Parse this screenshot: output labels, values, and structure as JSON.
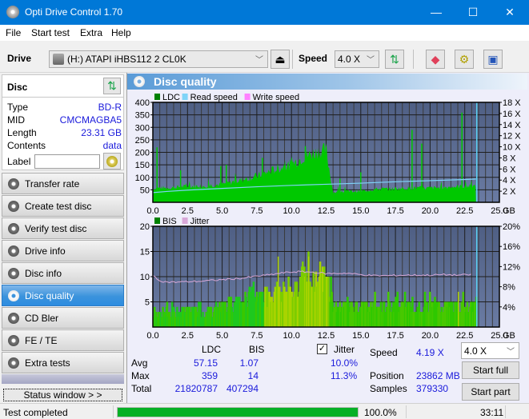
{
  "window": {
    "title": "Opti Drive Control 1.70",
    "minimize": "—",
    "maximize": "☐",
    "close": "✕"
  },
  "menu": [
    "File",
    "Start test",
    "Extra",
    "Help"
  ],
  "toolbar": {
    "drive_label": "Drive",
    "drive_value": "(H:)  ATAPI iHBS112  2 CL0K",
    "speed_label": "Speed",
    "speed_value": "4.0 X",
    "eject_icon": "eject-icon",
    "refresh_icon": "refresh-icon",
    "erase_icon": "eraser-icon",
    "settings_icon": "gears-icon",
    "save_icon": "save-icon"
  },
  "disc": {
    "header": "Disc",
    "type_label": "Type",
    "type_value": "BD-R",
    "mid_label": "MID",
    "mid_value": "CMCMAGBA5",
    "length_label": "Length",
    "length_value": "23.31 GB",
    "contents_label": "Contents",
    "contents_value": "data",
    "label_label": "Label",
    "label_value": ""
  },
  "nav": [
    {
      "label": "Transfer rate",
      "active": false
    },
    {
      "label": "Create test disc",
      "active": false
    },
    {
      "label": "Verify test disc",
      "active": false
    },
    {
      "label": "Drive info",
      "active": false
    },
    {
      "label": "Disc info",
      "active": false
    },
    {
      "label": "Disc quality",
      "active": true
    },
    {
      "label": "CD Bler",
      "active": false
    },
    {
      "label": "FE / TE",
      "active": false
    },
    {
      "label": "Extra tests",
      "active": false
    }
  ],
  "status_window_button": "Status window > >",
  "panel": {
    "title": "Disc quality"
  },
  "colors": {
    "ldc": "#00c800",
    "read_speed": "#7fd4f8",
    "write_speed": "#ff80ff",
    "bis": "#00c800",
    "jitter": "#d8a8d8",
    "plot_bg_top": "#4f5f84",
    "plot_bg_bottom": "#6a7ba3",
    "accent": "#0078d7"
  },
  "chart_data": [
    {
      "type": "area",
      "title": "LDC",
      "legend": [
        "LDC",
        "Read speed",
        "Write speed"
      ],
      "legend_position": "top-left",
      "xlabel": "GB",
      "x_ticks": [
        "0.0",
        "2.5",
        "5.0",
        "7.5",
        "10.0",
        "12.5",
        "15.0",
        "17.5",
        "20.0",
        "22.5",
        "25.0"
      ],
      "xlim": [
        0,
        25
      ],
      "y_ticks_left": [
        "50",
        "100",
        "150",
        "200",
        "250",
        "300",
        "350",
        "400"
      ],
      "ylim_left": [
        0,
        400
      ],
      "y_ticks_right": [
        "2 X",
        "4 X",
        "6 X",
        "8 X",
        "10 X",
        "12 X",
        "14 X",
        "16 X",
        "18 X"
      ],
      "ylim_right": [
        0,
        18
      ],
      "grid": true,
      "end_marker_x": 23.31,
      "series": [
        {
          "name": "LDC",
          "x": [
            0,
            0.5,
            1,
            1.5,
            2,
            2.5,
            3,
            3.5,
            4,
            4.5,
            5,
            5.5,
            6,
            6.5,
            7,
            7.5,
            8,
            8.5,
            9,
            9.5,
            10,
            10.5,
            11,
            11.5,
            12,
            12.5,
            13,
            13.5,
            14,
            14.5,
            15,
            15.5,
            16,
            16.5,
            17,
            17.5,
            18,
            18.5,
            19,
            19.5,
            20,
            20.5,
            21,
            21.5,
            22,
            22.5,
            23,
            23.31
          ],
          "values": [
            55,
            58,
            57,
            60,
            62,
            63,
            64,
            66,
            68,
            70,
            72,
            78,
            85,
            90,
            98,
            105,
            115,
            125,
            135,
            143,
            152,
            168,
            185,
            195,
            205,
            210,
            40,
            42,
            43,
            44,
            45,
            48,
            52,
            54,
            53,
            55,
            56,
            57,
            58,
            56,
            57,
            58,
            60,
            62,
            63,
            64,
            65,
            62
          ],
          "spikes": [
            {
              "x": 0.3,
              "v": 220
            },
            {
              "x": 2.0,
              "v": 128
            },
            {
              "x": 4.9,
              "v": 145
            },
            {
              "x": 5.3,
              "v": 150
            },
            {
              "x": 7.9,
              "v": 178
            },
            {
              "x": 11.0,
              "v": 225
            },
            {
              "x": 13.5,
              "v": 95
            },
            {
              "x": 15.0,
              "v": 120
            },
            {
              "x": 18.7,
              "v": 290
            },
            {
              "x": 19.4,
              "v": 235
            },
            {
              "x": 22.3,
              "v": 359
            }
          ]
        },
        {
          "name": "Read speed",
          "unit": "X",
          "x": [
            0,
            1,
            2.5,
            5,
            7.5,
            10,
            12.5,
            15,
            17.5,
            20,
            22.5,
            23.31
          ],
          "values": [
            1.75,
            1.95,
            2.2,
            2.5,
            2.8,
            3.05,
            3.25,
            3.45,
            3.7,
            3.9,
            4.1,
            4.19
          ]
        }
      ]
    },
    {
      "type": "bar",
      "title": "BIS",
      "legend": [
        "BIS",
        "Jitter"
      ],
      "legend_position": "top-left",
      "xlabel": "GB",
      "x_ticks": [
        "0.0",
        "2.5",
        "5.0",
        "7.5",
        "10.0",
        "12.5",
        "15.0",
        "17.5",
        "20.0",
        "22.5",
        "25.0"
      ],
      "xlim": [
        0,
        25
      ],
      "y_ticks_left": [
        "5",
        "10",
        "15",
        "20"
      ],
      "ylim_left": [
        0,
        20
      ],
      "y_ticks_right": [
        "4%",
        "8%",
        "12%",
        "16%",
        "20%"
      ],
      "ylim_right": [
        0,
        20
      ],
      "grid": true,
      "end_marker_x": 23.31,
      "series": [
        {
          "name": "BIS",
          "x": [
            0,
            0.5,
            1,
            1.5,
            2,
            2.5,
            3,
            3.5,
            4,
            4.5,
            5,
            5.5,
            6,
            6.5,
            7,
            7.5,
            8,
            8.5,
            9,
            9.5,
            10,
            10.5,
            11,
            11.5,
            12,
            12.5,
            13,
            13.5,
            14,
            14.5,
            15,
            15.5,
            16,
            16.5,
            17,
            17.5,
            18,
            18.5,
            19,
            19.5,
            20,
            20.5,
            21,
            21.5,
            22,
            22.5,
            23
          ],
          "values": [
            4,
            3,
            3,
            3,
            4,
            4,
            4,
            4,
            4,
            5,
            5,
            6,
            6,
            6,
            7,
            8,
            8,
            8,
            9,
            9,
            9,
            11,
            12,
            11,
            12,
            12,
            5,
            5,
            5,
            5,
            5,
            5,
            5,
            5,
            5,
            5,
            5,
            5,
            5,
            5,
            5,
            5,
            5,
            5,
            5,
            5,
            5
          ],
          "peaks": [
            {
              "x": 9.0,
              "v": 14
            },
            {
              "x": 11.2,
              "v": 14
            },
            {
              "x": 22.0,
              "v": 7
            }
          ]
        },
        {
          "name": "Jitter",
          "unit": "%",
          "x": [
            0,
            0.3,
            0.8,
            1.5,
            2.5,
            3.5,
            5,
            6.5,
            7.5,
            8.5,
            9.5,
            10.5,
            11.5,
            12.5,
            14,
            15,
            16,
            17,
            18,
            19,
            20,
            21,
            22,
            23
          ],
          "values": [
            10.2,
            9.5,
            9.0,
            8.9,
            9.0,
            9.1,
            9.4,
            9.7,
            10.1,
            10.4,
            10.8,
            11.0,
            10.9,
            10.6,
            10.7,
            10.4,
            10.2,
            10.2,
            10.3,
            10.3,
            10.3,
            10.4,
            10.3,
            10.4
          ]
        }
      ]
    }
  ],
  "stats": {
    "col_ldc": "LDC",
    "col_bis": "BIS",
    "row_avg": "Avg",
    "row_max": "Max",
    "row_total": "Total",
    "ldc_avg": "57.15",
    "bis_avg": "1.07",
    "ldc_max": "359",
    "bis_max": "14",
    "ldc_total": "21820787",
    "bis_total": "407294",
    "jitter_checked": true,
    "jitter_label": "Jitter",
    "jitter_avg": "10.0%",
    "jitter_max": "11.3%",
    "speed_label": "Speed",
    "speed_value": "4.19 X",
    "position_label": "Position",
    "position_value": "23862 MB",
    "samples_label": "Samples",
    "samples_value": "379330",
    "speed_select": "4.0 X",
    "start_full": "Start full",
    "start_part": "Start part"
  },
  "statusbar": {
    "text": "Test completed",
    "progress": 1.0,
    "percent": "100.0%",
    "time": "33:11"
  }
}
